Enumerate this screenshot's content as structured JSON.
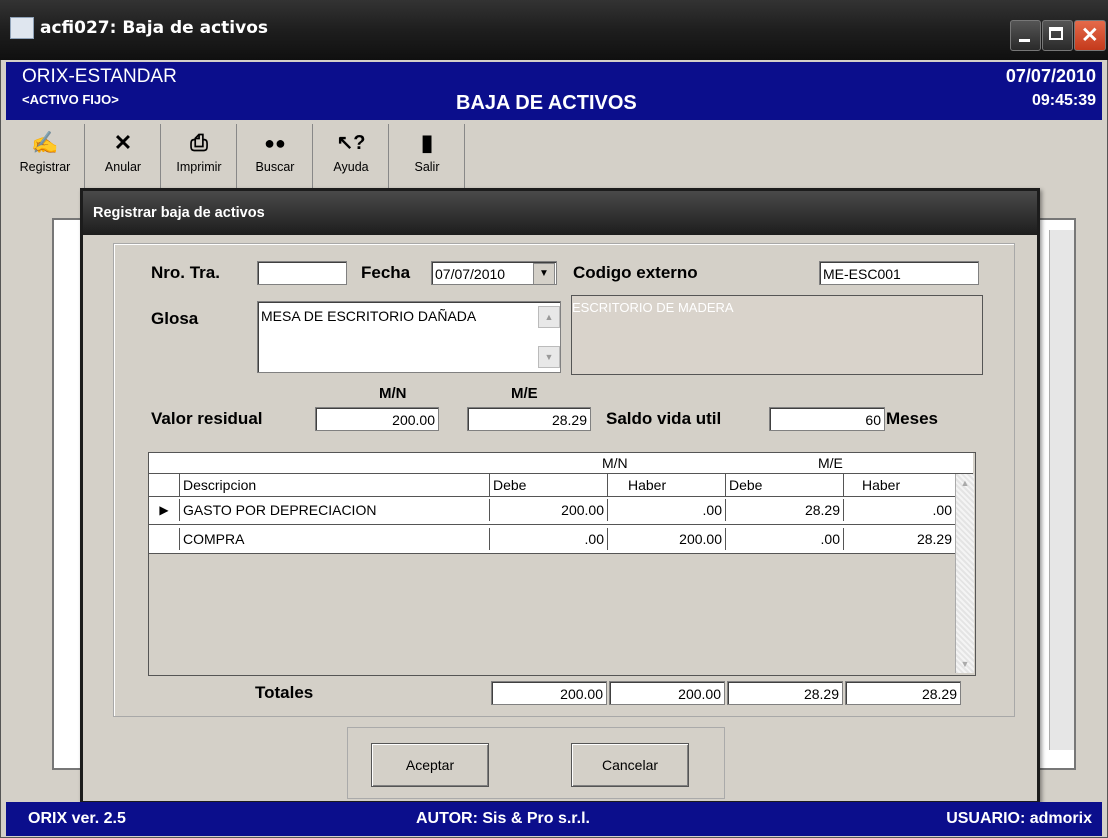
{
  "window": {
    "title": "acfi027: Baja de activos"
  },
  "header": {
    "app_name": "ORIX-ESTANDAR",
    "module": "<ACTIVO FIJO>",
    "screen_title": "BAJA DE ACTIVOS",
    "date": "07/07/2010",
    "time": "09:45:39"
  },
  "toolbar": [
    {
      "label": "Registrar",
      "icon": "pen-icon",
      "glyph": "✍"
    },
    {
      "label": "Anular",
      "icon": "x-icon",
      "glyph": "✕"
    },
    {
      "label": "Imprimir",
      "icon": "printer-icon",
      "glyph": "⎙"
    },
    {
      "label": "Buscar",
      "icon": "binoculars-icon",
      "glyph": "👀"
    },
    {
      "label": "Ayuda",
      "icon": "help-icon",
      "glyph": "↖?"
    },
    {
      "label": "Salir",
      "icon": "exit-door-icon",
      "glyph": "⍈"
    }
  ],
  "dialog": {
    "title": "Registrar baja de activos",
    "nro_tra_label": "Nro. Tra.",
    "nro_tra_value": "",
    "fecha_label": "Fecha",
    "fecha_value": "07/07/2010",
    "codigo_label": "Codigo externo",
    "codigo_value": "ME-ESC001",
    "glosa_label": "Glosa",
    "glosa_value": "MESA DE ESCRITORIO DAÑADA",
    "descripcion_value": "ESCRITORIO DE MADERA",
    "mn_label": "M/N",
    "me_label": "M/E",
    "valor_residual_label": "Valor residual",
    "valor_residual_mn": "200.00",
    "valor_residual_me": "28.29",
    "saldo_label": "Saldo vida util",
    "saldo_value": "60",
    "meses_label": "Meses",
    "totales_label": "Totales",
    "totals": [
      "200.00",
      "200.00",
      "28.29",
      "28.29"
    ],
    "accept_label": "Aceptar",
    "cancel_label": "Cancelar"
  },
  "grid": {
    "group_headers": [
      "M/N",
      "M/E"
    ],
    "columns": [
      "Descripcion",
      "Debe",
      "Haber",
      "Debe",
      "Haber"
    ],
    "rows": [
      [
        "GASTO POR DEPRECIACION",
        "200.00",
        ".00",
        "28.29",
        ".00"
      ],
      [
        "COMPRA",
        ".00",
        "200.00",
        ".00",
        "28.29"
      ]
    ]
  },
  "status": {
    "version": "ORIX ver. 2.5",
    "author": "AUTOR: Sis & Pro s.r.l.",
    "user": "USUARIO: admorix"
  },
  "colors": {
    "header_bg": "#0b0e8c",
    "dialog_bg": "#d4d0c8",
    "titlebar": "#1d1d1d"
  }
}
